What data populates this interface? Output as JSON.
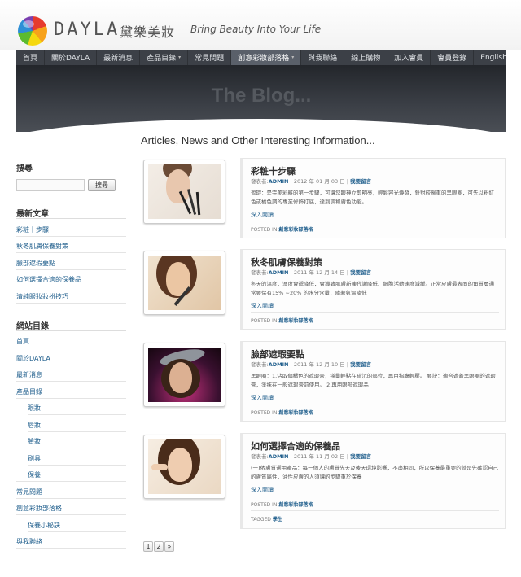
{
  "header": {
    "logo_word": "DAYLA",
    "logo_cn": "黛樂美妝",
    "tagline": "Bring Beauty Into Your Life"
  },
  "nav": {
    "items": [
      {
        "label": "首頁"
      },
      {
        "label": "關於DAYLA"
      },
      {
        "label": "最新消息"
      },
      {
        "label": "產品目錄"
      },
      {
        "label": "常見問題"
      },
      {
        "label": "創意彩妝部落格"
      },
      {
        "label": "與我聯絡"
      }
    ],
    "right_items": [
      {
        "label": "線上購物"
      },
      {
        "label": "加入會員"
      },
      {
        "label": "會員登錄"
      },
      {
        "label": "English"
      }
    ],
    "caret": "▾"
  },
  "banner": {
    "title": "The Blog..."
  },
  "main": {
    "heading": "Articles, News and Other Interesting Information..."
  },
  "sidebar": {
    "search": {
      "title": "搜尋",
      "placeholder": "",
      "button": "搜尋"
    },
    "recent": {
      "title": "最新文章",
      "items": [
        "彩粧十步驟",
        "秋冬肌膚保養對策",
        "臉部遮瑕要點",
        "如何選擇合適的保養品",
        "清純眼妝妝扮技巧"
      ]
    },
    "categories": {
      "title": "網站目錄",
      "items": [
        "首頁",
        "關於DAYLA",
        "最新消息",
        "產品目錄",
        "眼妝",
        "唇妝",
        "臉妝",
        "刷具",
        "保養",
        "常見問題",
        "創意彩妝部落格",
        "保養小秘訣",
        "與我聯絡"
      ]
    }
  },
  "posts": [
    {
      "title": "彩粧十步驟",
      "by": "發表者:",
      "author": "ADMIN",
      "date": "2012 年 01 月 03 日",
      "sep": "|",
      "comment": "我要留言",
      "excerpt": "遮瑕：是完美彩粧的第一步驟，可讓您眼神立即明亮，輕鬆容光煥發，針對較嚴重的黑眼圈，可先以粉紅色或橘色調的專業修飾打底，達到調和膚色功能。.",
      "more": "深入閱讀",
      "posted_in_label": "POSTED IN",
      "posted_in": "創意彩妝部落格"
    },
    {
      "title": "秋冬肌膚保養對策",
      "by": "發表者:",
      "author": "ADMIN",
      "date": "2011 年 12 月 14 日",
      "sep": "|",
      "comment": "我要留言",
      "excerpt": "冬天的溫度，溼度會遞降低，會導致肌膚新陳代謝降低、細胞活動速度減緩。正常皮膚最表面的角質層通常要保有15% ~20% 的水分含量，隨著氣溫降低",
      "more": "深入閱讀",
      "posted_in_label": "POSTED IN",
      "posted_in": "創意彩妝部落格"
    },
    {
      "title": "臉部遮瑕要點",
      "by": "發表者:",
      "author": "ADMIN",
      "date": "2011 年 12 月 10 日",
      "sep": "|",
      "comment": "我要留言",
      "excerpt": "黑眼圈：1.沾取偏橘色的遮瑕膏，搽量輕點在暗沉的部位，再用指腹輕壓。 要訣：適合遮蓋黑眼圈的遮瑕膏，塗抹在一般遮瑕膏前使用。 2.再用眼部遮瑕品",
      "more": "深入閱讀",
      "posted_in_label": "POSTED IN",
      "posted_in": "創意彩妝部落格"
    },
    {
      "title": "如何選擇合適的保養品",
      "by": "發表者:",
      "author": "ADMIN",
      "date": "2011 年 11 月 02 日",
      "sep": "|",
      "comment": "我要留言",
      "excerpt": "(一)依膚質選用產品：每一個人的膚質先天及後天環境影響，不盡相同，所以保養最重要的就是先確認自己的膚質屬性，油性皮膚的人須讓的步驟重於保養",
      "more": "深入閱讀",
      "posted_in_label": "POSTED IN",
      "posted_in": "創意彩妝部落格",
      "tagged_label": "TAGGED",
      "tagged": "學生"
    }
  ],
  "pagination": {
    "pages": [
      "1",
      "2"
    ],
    "next": "»"
  }
}
